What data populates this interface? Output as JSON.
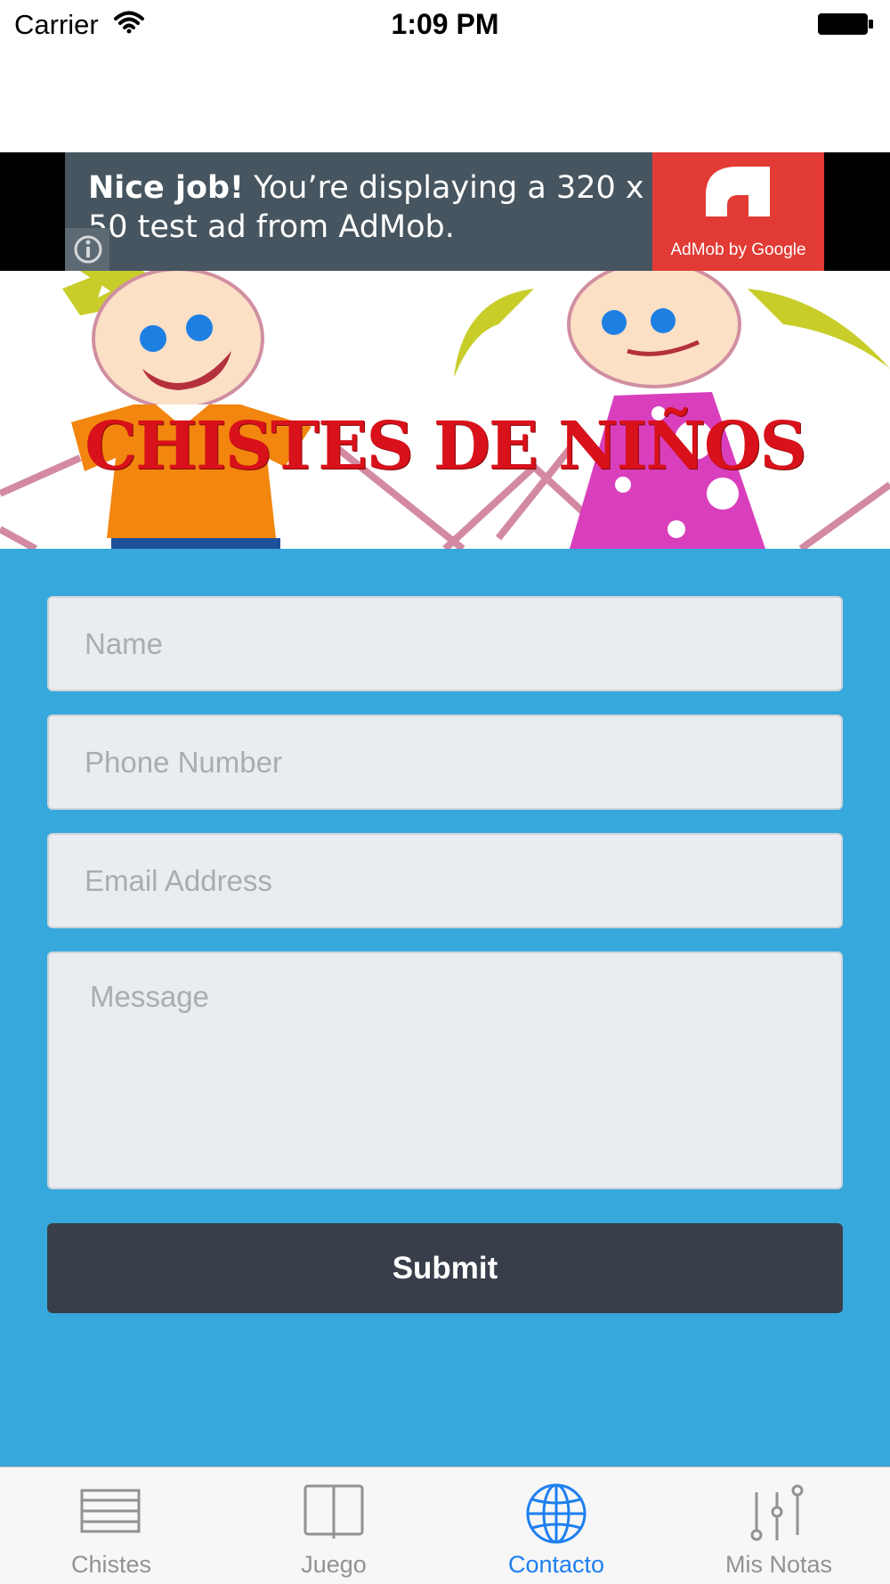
{
  "status_bar": {
    "carrier": "Carrier",
    "time": "1:09 PM",
    "icons": [
      "wifi-icon",
      "battery-icon"
    ]
  },
  "ad": {
    "headline_bold": "Nice job!",
    "headline_rest": " You’re displaying a 320 x 50 test ad from AdMob.",
    "logo_caption": "AdMob by Google",
    "colors": {
      "panel": "#46555f",
      "logo": "#e23b35"
    }
  },
  "header": {
    "title": "CHISTES DE NIÑOS"
  },
  "form": {
    "name_placeholder": "Name",
    "phone_placeholder": "Phone Number",
    "email_placeholder": "Email Address",
    "message_placeholder": "Message",
    "submit_label": "Submit",
    "background": "#36a8db"
  },
  "tabs": [
    {
      "label": "Chistes",
      "icon": "list-icon",
      "active": false
    },
    {
      "label": "Juego",
      "icon": "book-icon",
      "active": false
    },
    {
      "label": "Contacto",
      "icon": "globe-icon",
      "active": true
    },
    {
      "label": "Mis Notas",
      "icon": "sliders-icon",
      "active": false
    }
  ],
  "colors": {
    "accent": "#1e7ff0",
    "inactive": "#929292",
    "submit": "#393f4a"
  }
}
